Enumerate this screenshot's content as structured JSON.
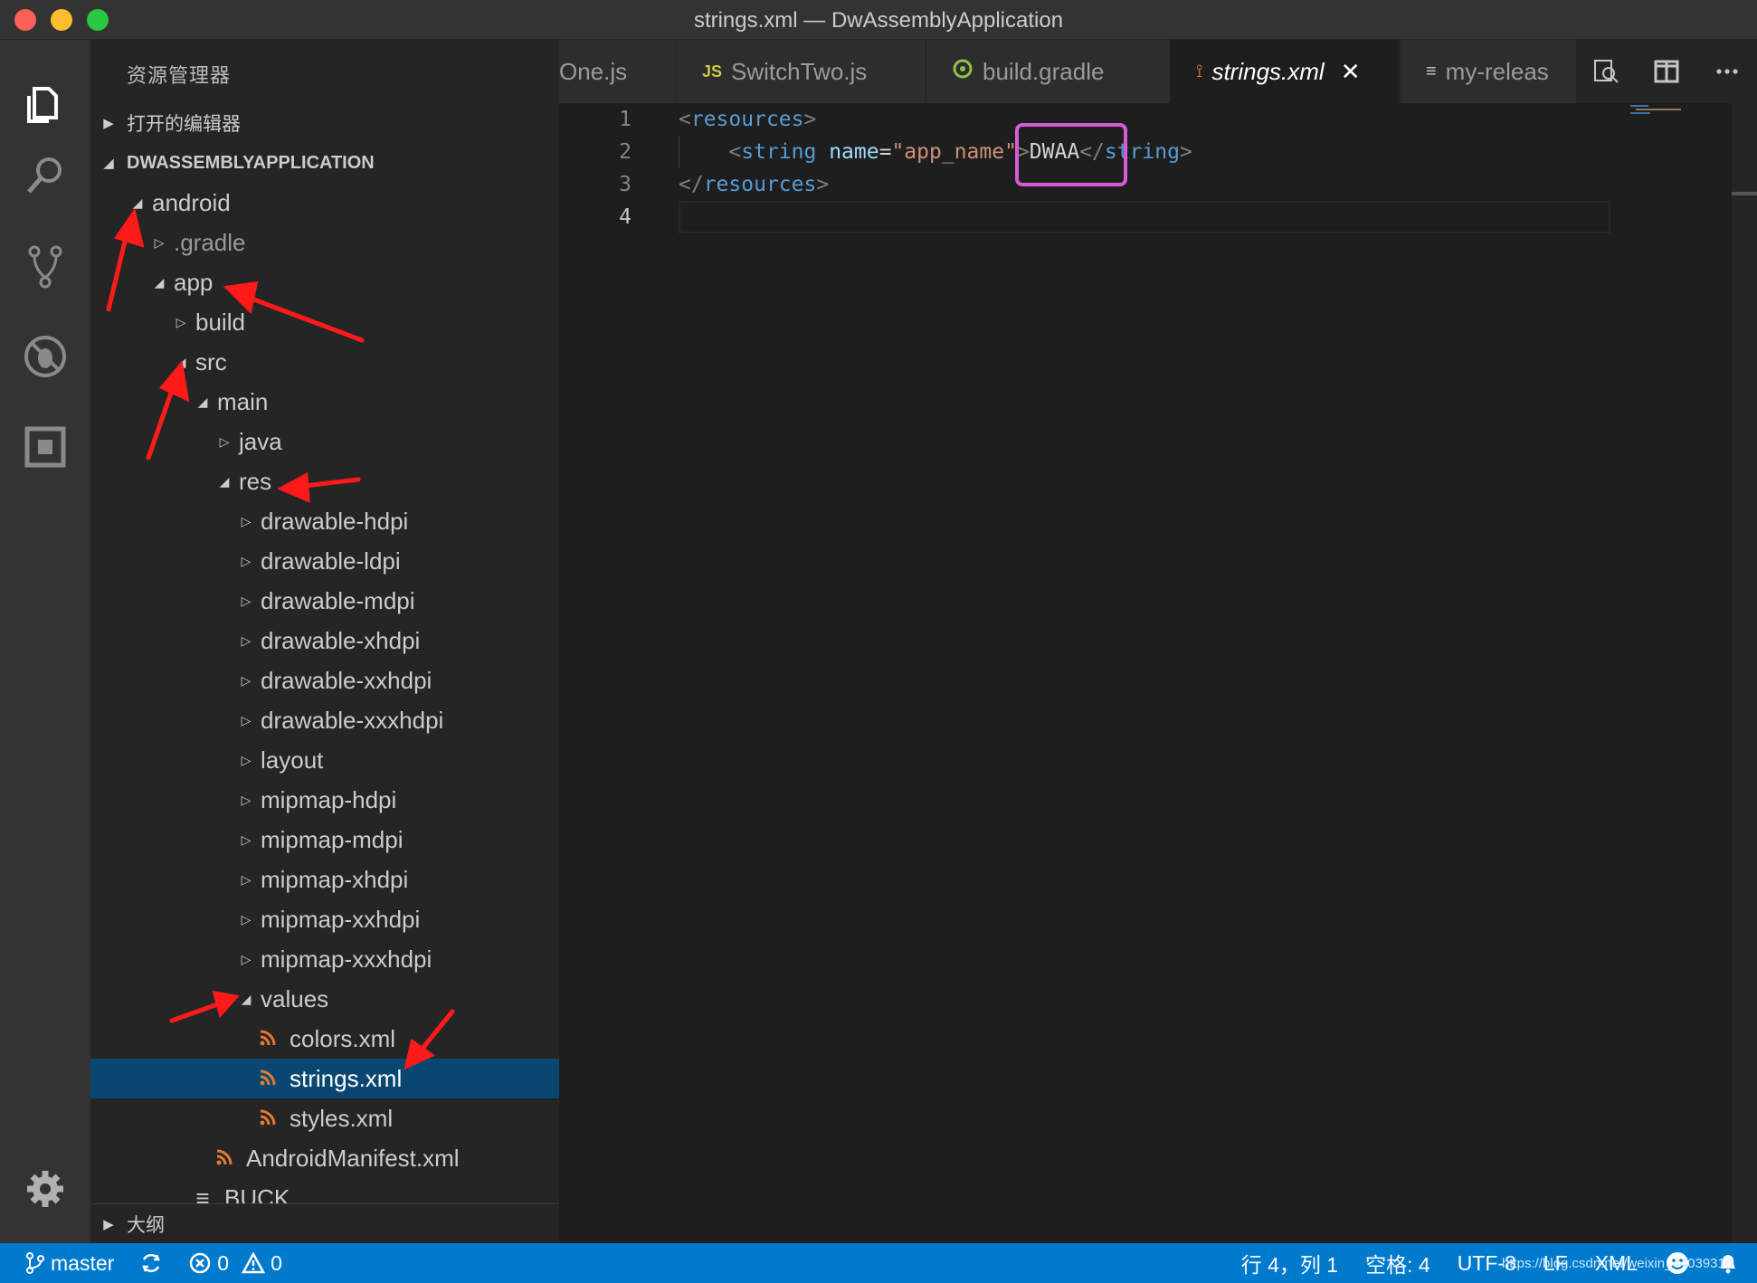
{
  "window": {
    "title": "strings.xml — DwAssemblyApplication"
  },
  "sidebar": {
    "title": "资源管理器",
    "sections": {
      "open_editors": "打开的编辑器",
      "workspace": "DWASSEMBLYAPPLICATION",
      "outline": "大纲"
    },
    "tree": [
      {
        "label": "android",
        "expanded": true
      },
      {
        "label": ".gradle",
        "expanded": false,
        "dim": true
      },
      {
        "label": "app",
        "expanded": true
      },
      {
        "label": "build",
        "expanded": false
      },
      {
        "label": "src",
        "expanded": true
      },
      {
        "label": "main",
        "expanded": true
      },
      {
        "label": "java",
        "expanded": false
      },
      {
        "label": "res",
        "expanded": true
      },
      {
        "label": "drawable-hdpi",
        "expanded": false
      },
      {
        "label": "drawable-ldpi",
        "expanded": false
      },
      {
        "label": "drawable-mdpi",
        "expanded": false
      },
      {
        "label": "drawable-xhdpi",
        "expanded": false
      },
      {
        "label": "drawable-xxhdpi",
        "expanded": false
      },
      {
        "label": "drawable-xxxhdpi",
        "expanded": false
      },
      {
        "label": "layout",
        "expanded": false
      },
      {
        "label": "mipmap-hdpi",
        "expanded": false
      },
      {
        "label": "mipmap-mdpi",
        "expanded": false
      },
      {
        "label": "mipmap-xhdpi",
        "expanded": false
      },
      {
        "label": "mipmap-xxhdpi",
        "expanded": false
      },
      {
        "label": "mipmap-xxxhdpi",
        "expanded": false
      },
      {
        "label": "values",
        "expanded": true
      },
      {
        "label": "colors.xml",
        "file": "xml"
      },
      {
        "label": "strings.xml",
        "file": "xml",
        "selected": true
      },
      {
        "label": "styles.xml",
        "file": "xml"
      },
      {
        "label": "AndroidManifest.xml",
        "file": "xml"
      },
      {
        "label": "BUCK",
        "file": "text"
      }
    ]
  },
  "tabs": [
    {
      "label": "One.js",
      "icon": ""
    },
    {
      "label": "SwitchTwo.js",
      "icon": "JS"
    },
    {
      "label": "build.gradle",
      "icon": "gradle-icon"
    },
    {
      "label": "strings.xml",
      "icon": "rss-icon",
      "active": true
    },
    {
      "label": "my-releas",
      "icon": "text-icon"
    }
  ],
  "editor": {
    "line_numbers": [
      "1",
      "2",
      "3",
      "4"
    ],
    "current_line": "4",
    "code": {
      "l1_open": "<",
      "l1_tag": "resources",
      "l1_close": ">",
      "l2_indent": "    ",
      "l2_open": "<",
      "l2_tag": "string",
      "l2_space": " ",
      "l2_attr": "name",
      "l2_eq": "=",
      "l2_val": "\"app_name\"",
      "l2_gt": ">",
      "l2_text": "DWAA",
      "l2_end_open": "</",
      "l2_end_tag": "string",
      "l2_end_close": ">",
      "l3_open": "</",
      "l3_tag": "resources",
      "l3_close": ">"
    }
  },
  "statusbar": {
    "branch": "master",
    "errors": "0",
    "warnings": "0",
    "position": "行 4，列 1",
    "spaces": "空格: 4",
    "encoding": "UTF-8",
    "eol": "LF",
    "language": "XML",
    "watermark": "https://blog.csdn.net/weixin_44039310"
  },
  "colors": {
    "statusbar": "#007acc",
    "selection": "#094771",
    "highlight_box": "#d65cd6",
    "annotation_arrow": "#ff1a1a"
  }
}
